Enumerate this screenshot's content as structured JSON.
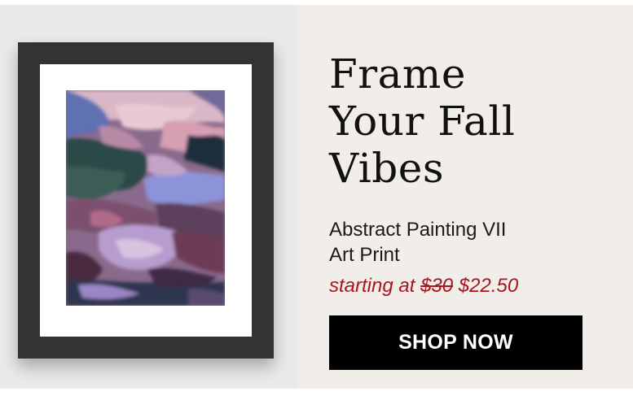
{
  "headline": {
    "line1": "Frame",
    "line2": "Your Fall",
    "line3": "Vibes"
  },
  "product": {
    "name_line1": "Abstract Painting VII",
    "name_line2": "Art Print"
  },
  "pricing": {
    "prefix": "starting at",
    "original_price": "$30",
    "sale_price": "$22.50"
  },
  "cta": {
    "label": "SHOP NOW"
  },
  "colors": {
    "left_background": "#e9e9e9",
    "right_background": "#f1ede8",
    "frame": "#333333",
    "price_accent": "#a8161f",
    "button": "#000000"
  }
}
